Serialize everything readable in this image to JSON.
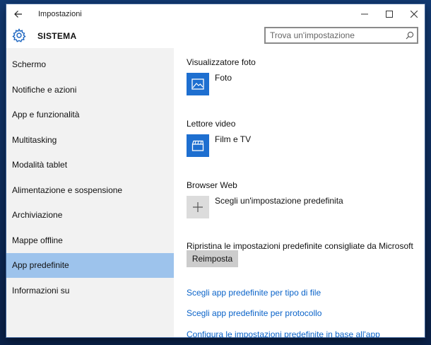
{
  "window": {
    "title": "Impostazioni"
  },
  "header": {
    "section": "SISTEMA",
    "search_placeholder": "Trova un'impostazione"
  },
  "sidebar": {
    "items": [
      {
        "label": "Schermo"
      },
      {
        "label": "Notifiche e azioni"
      },
      {
        "label": "App e funzionalità"
      },
      {
        "label": "Multitasking"
      },
      {
        "label": "Modalità tablet"
      },
      {
        "label": "Alimentazione e sospensione"
      },
      {
        "label": "Archiviazione"
      },
      {
        "label": "Mappe offline"
      },
      {
        "label": "App predefinite"
      },
      {
        "label": "Informazioni su"
      }
    ],
    "selected": "App predefinite"
  },
  "content": {
    "photo": {
      "title": "Visualizzatore foto",
      "app": "Foto"
    },
    "video": {
      "title": "Lettore video",
      "app": "Film e TV"
    },
    "browser": {
      "title": "Browser Web",
      "app": "Scegli un'impostazione predefinita"
    },
    "reset": {
      "title": "Ripristina le impostazioni predefinite consigliate da Microsoft",
      "button": "Reimposta"
    },
    "links": [
      "Scegli app predefinite per tipo di file",
      "Scegli app predefinite per protocollo",
      "Configura le impostazioni predefinite in base all'app"
    ]
  },
  "colors": {
    "accent": "#1e6fd0",
    "selected_nav": "#9dc3ec",
    "link": "#0a63c9"
  }
}
